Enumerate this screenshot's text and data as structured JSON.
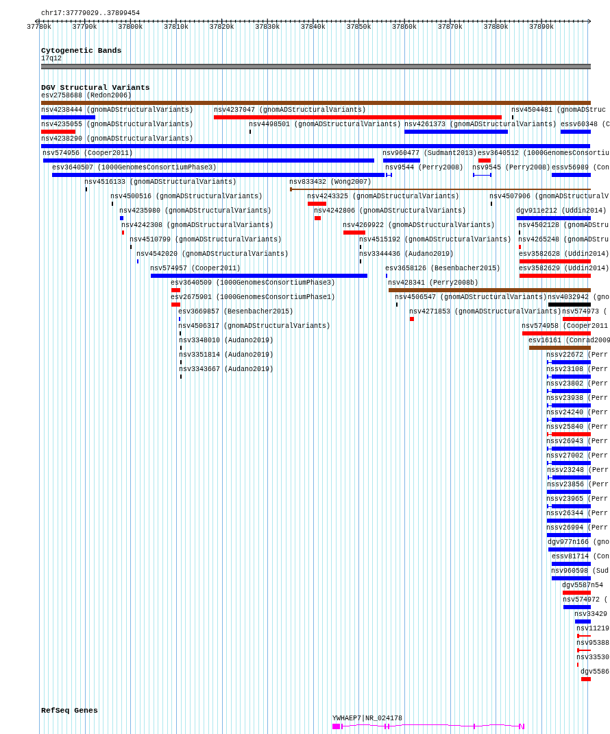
{
  "ruler": {
    "position": "chr17:37779029..37899454",
    "ticks": [
      "37780k",
      "37790k",
      "37800k",
      "37810k",
      "37820k",
      "37830k",
      "37840k",
      "37850k",
      "37860k",
      "37870k",
      "37880k",
      "37890k"
    ]
  },
  "tracks": [
    {
      "kind": "cytoband",
      "title": "Cytogenetic Bands",
      "bands": [
        {
          "label": "17q12"
        }
      ]
    },
    {
      "kind": "variants",
      "title": "DGV Structural Variants",
      "features": [
        {
          "label": "esv2758688 (Redon2006)",
          "kind": "bar",
          "color": "#8b4513"
        },
        {
          "label": "nsv4238444 (gnomADStructuralVariants)",
          "kind": "bar",
          "color": "#0000ff"
        },
        {
          "label": "nsv4237047 (gnomADStructuralVariants)",
          "kind": "bar",
          "color": "#ff0000"
        },
        {
          "label": "nsv4504481 (gnomADStruc",
          "kind": "tick",
          "color": "#000000"
        },
        {
          "label": "nsv4235055 (gnomADStructuralVariants)",
          "kind": "bar",
          "color": "#ff0000"
        },
        {
          "label": "nsv4498501 (gnomADStructuralVariants)",
          "kind": "tick",
          "color": "#000000"
        },
        {
          "label": "nsv4261373 (gnomADStructuralVariants)",
          "kind": "bar",
          "color": "#0000ff"
        },
        {
          "label": "essv60348 (C",
          "kind": "bar",
          "color": "#0000ff"
        },
        {
          "label": "nsv4238290 (gnomADStructuralVariants)",
          "kind": "bar",
          "color": "#0000ff"
        },
        {
          "label": "nsv574956 (Cooper2011)",
          "kind": "bar",
          "color": "#0000ff"
        },
        {
          "label": "nsv960477 (Sudmant2013)",
          "kind": "bar",
          "color": "#0000ff"
        },
        {
          "label": "esv3640512 (1000GenomesConsortiu",
          "kind": "bar",
          "color": "#ff0000"
        },
        {
          "label": "esv3640507 (1000GenomesConsortiumPhase3)",
          "kind": "bar",
          "color": "#0000ff"
        },
        {
          "label": "nsv9544 (Perry2008)",
          "kind": "interval",
          "color": "#0000ff"
        },
        {
          "label": "nsv9545 (Perry2008)",
          "kind": "interval",
          "color": "#0000ff"
        },
        {
          "label": "essv56989 (Con",
          "kind": "bar",
          "color": "#0000ff"
        },
        {
          "label": "nsv4516133 (gnomADStructuralVariants)",
          "kind": "tick",
          "color": "#000000"
        },
        {
          "label": "nsv833432 (Wong2007)",
          "kind": "line",
          "color": "#8b4513"
        },
        {
          "label": "nsv4500516 (gnomADStructuralVariants)",
          "kind": "tick",
          "color": "#000000"
        },
        {
          "label": "nsv4243325 (gnomADStructuralVariants)",
          "kind": "bar",
          "color": "#ff0000"
        },
        {
          "label": "nsv4507906 (gnomADStructuralV",
          "kind": "tick",
          "color": "#000000"
        },
        {
          "label": "nsv4235980 (gnomADStructuralVariants)",
          "kind": "bar",
          "color": "#0000ff"
        },
        {
          "label": "nsv4242806 (gnomADStructuralVariants)",
          "kind": "bar",
          "color": "#ff0000"
        },
        {
          "label": "dgv911e212 (Uddin2014)",
          "kind": "bar",
          "color": "#0000ff"
        },
        {
          "label": "nsv4242308 (gnomADStructuralVariants)",
          "kind": "bar",
          "color": "#ff0000"
        },
        {
          "label": "nsv4269922 (gnomADStructuralVariants)",
          "kind": "bar",
          "color": "#ff0000"
        },
        {
          "label": "nsv4502128 (gnomADStru",
          "kind": "tick",
          "color": "#000000"
        },
        {
          "label": "nsv4510799 (gnomADStructuralVariants)",
          "kind": "tick",
          "color": "#000000"
        },
        {
          "label": "nsv4515192 (gnomADStructuralVariants)",
          "kind": "tick",
          "color": "#000000"
        },
        {
          "label": "nsv4265248 (gnomADStru",
          "kind": "bar",
          "color": "#ff0000"
        },
        {
          "label": "nsv4542020 (gnomADStructuralVariants)",
          "kind": "bar",
          "color": "#0000ff"
        },
        {
          "label": "nsv3344436 (Audano2019)",
          "kind": "tick",
          "color": "#000000"
        },
        {
          "label": "esv3582628 (Uddin2014)",
          "kind": "bar",
          "color": "#ff0000"
        },
        {
          "label": "nsv574957 (Cooper2011)",
          "kind": "bar",
          "color": "#0000ff"
        },
        {
          "label": "esv3658126 (Besenbacher2015)",
          "kind": "bar",
          "color": "#0000ff"
        },
        {
          "label": "esv3582629 (Uddin2014)",
          "kind": "bar",
          "color": "#ff0000"
        },
        {
          "label": "esv3640509 (1000GenomesConsortiumPhase3)",
          "kind": "bar",
          "color": "#ff0000"
        },
        {
          "label": "nsv428341 (Perry2008b)",
          "kind": "bar",
          "color": "#8b4513"
        },
        {
          "label": "esv2675901 (1000GenomesConsortiumPhase1)",
          "kind": "bar",
          "color": "#ff0000"
        },
        {
          "label": "nsv4506547 (gnomADStructuralVariants)",
          "kind": "tick",
          "color": "#000000"
        },
        {
          "label": "nsv4032942 (gno",
          "kind": "bar",
          "color": "#000000"
        },
        {
          "label": "esv3669857 (Besenbacher2015)",
          "kind": "bar",
          "color": "#0000ff"
        },
        {
          "label": "nsv4271853 (gnomADStructuralVariants)",
          "kind": "bar",
          "color": "#ff0000"
        },
        {
          "label": "nsv574973 (",
          "kind": "bar",
          "color": "#ff0000"
        },
        {
          "label": "nsv4506317 (gnomADStructuralVariants)",
          "kind": "tick",
          "color": "#000000"
        },
        {
          "label": "nsv574958 (Cooper2011",
          "kind": "bar",
          "color": "#ff0000"
        },
        {
          "label": "nsv3348010 (Audano2019)",
          "kind": "tick",
          "color": "#000000"
        },
        {
          "label": "esv16161 (Conrad2009",
          "kind": "bar",
          "color": "#8b4513"
        },
        {
          "label": "nsv3351814 (Audano2019)",
          "kind": "tick",
          "color": "#000000"
        },
        {
          "label": "nssv22672 (Perr",
          "kind": "whisker",
          "color": "#0000ff"
        },
        {
          "label": "nsv3343667 (Audano2019)",
          "kind": "tick",
          "color": "#000000"
        },
        {
          "label": "nssv23108 (Perr",
          "kind": "whisker",
          "color": "#0000ff"
        },
        {
          "label": "nssv23802 (Perr",
          "kind": "whisker",
          "color": "#0000ff"
        },
        {
          "label": "nssv23938 (Perr",
          "kind": "whisker",
          "color": "#0000ff"
        },
        {
          "label": "nssv24240 (Perr",
          "kind": "whisker",
          "color": "#0000ff"
        },
        {
          "label": "nssv25840 (Perr",
          "kind": "whisker",
          "color": "#ff0000"
        },
        {
          "label": "nssv26943 (Perr",
          "kind": "whisker",
          "color": "#0000ff"
        },
        {
          "label": "nssv27002 (Perr",
          "kind": "whisker",
          "color": "#0000ff"
        },
        {
          "label": "nssv23248 (Perr",
          "kind": "whisker",
          "color": "#0000ff"
        },
        {
          "label": "nssv23856 (Perr",
          "kind": "bar",
          "color": "#0000ff"
        },
        {
          "label": "nssv23965 (Perr",
          "kind": "whisker",
          "color": "#0000ff"
        },
        {
          "label": "nssv26344 (Perr",
          "kind": "bar",
          "color": "#0000ff"
        },
        {
          "label": "nssv26994 (Perr",
          "kind": "bar",
          "color": "#0000ff"
        },
        {
          "label": "dgv977n166 (gno",
          "kind": "bar",
          "color": "#0000ff"
        },
        {
          "label": "essv81714 (Con",
          "kind": "bar",
          "color": "#0000ff"
        },
        {
          "label": "nsv960598 (Sud",
          "kind": "bar",
          "color": "#0000ff"
        },
        {
          "label": "dgv5587n54",
          "kind": "bar",
          "color": "#ff0000"
        },
        {
          "label": "nsv574972 (",
          "kind": "bar",
          "color": "#0000ff"
        },
        {
          "label": "nsv33429",
          "kind": "bar",
          "color": "#0000ff"
        },
        {
          "label": "nsv11219",
          "kind": "line",
          "color": "#ff0000"
        },
        {
          "label": "nsv95388",
          "kind": "line",
          "color": "#ff0000"
        },
        {
          "label": "nsv33530",
          "kind": "tick",
          "color": "#ff0000"
        },
        {
          "label": "dgv5586",
          "kind": "bar",
          "color": "#ff0000"
        }
      ]
    },
    {
      "kind": "genes",
      "title": "RefSeq Genes",
      "features": [
        {
          "label": "YWHAEP7|NR_024178",
          "color": "#ff00ff"
        }
      ]
    }
  ]
}
